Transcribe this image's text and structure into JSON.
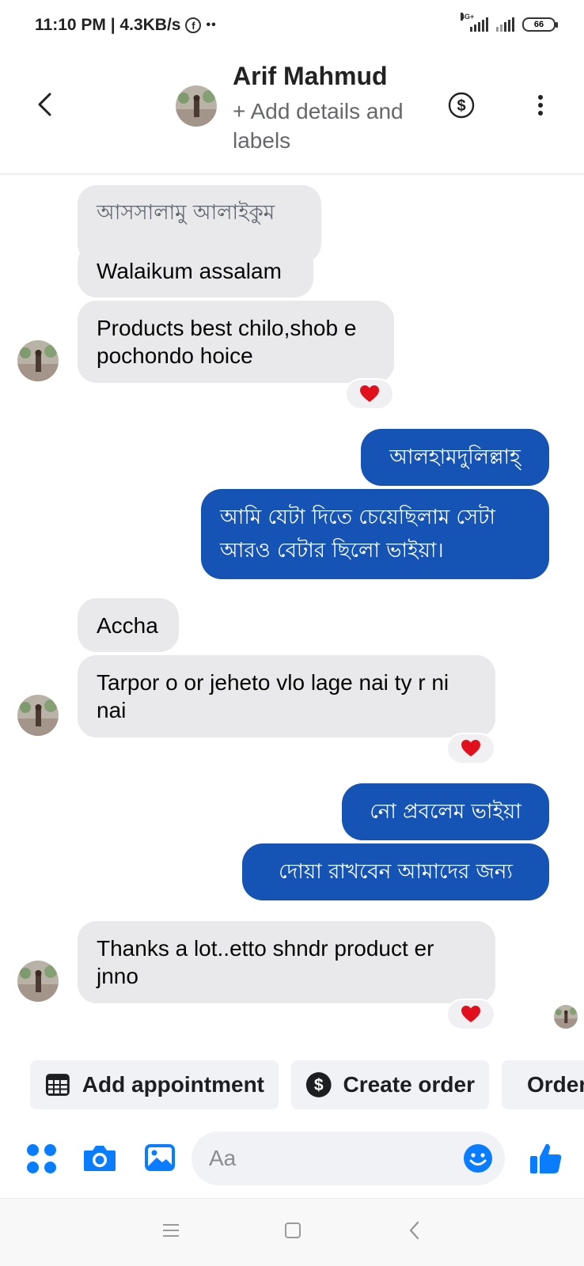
{
  "status_bar": {
    "time_speed": "11:10 PM | 4.3KB/s",
    "fb_glyph": "f",
    "more_dots": "••",
    "network": "4G+",
    "battery": "66"
  },
  "header": {
    "name": "Arif Mahmud",
    "subtitle": "+ Add details and labels"
  },
  "messages": [
    {
      "text": "আসসালামু আলাইকুম"
    },
    {
      "text": "Walaikum assalam"
    },
    {
      "text": "Products best chilo,shob e pochondo hoice"
    },
    {
      "text": "আলহামদুলিল্লাহ্"
    },
    {
      "text": "আমি যেটা দিতে চেয়েছিলাম সেটা আরও বেটার ছিলো ভাইয়া।"
    },
    {
      "text": "Accha"
    },
    {
      "text": "Tarpor o or jeheto vlo lage nai ty r ni nai"
    },
    {
      "text": "নো প্রবলেম ভাইয়া"
    },
    {
      "text": "দোয়া রাখবেন আমাদের জন্য"
    },
    {
      "text": "Thanks a lot..etto shndr product er jnno"
    }
  ],
  "quick_actions": {
    "add_appointment": "Add appointment",
    "create_order": "Create order",
    "orders": "Orders"
  },
  "composer": {
    "placeholder": "Aa"
  },
  "colors": {
    "outgoing_bubble": "#1553b5",
    "incoming_bubble": "#e9e9eb",
    "messenger_blue": "#0a7cff",
    "reaction_heart": "#e0101c"
  },
  "icons": [
    "back-arrow-icon",
    "dollar-circle-icon",
    "more-vertical-icon",
    "heart-icon",
    "calendar-icon",
    "order-list-icon",
    "apps-icon",
    "camera-icon",
    "image-icon",
    "emoji-icon",
    "thumbs-up-icon"
  ]
}
